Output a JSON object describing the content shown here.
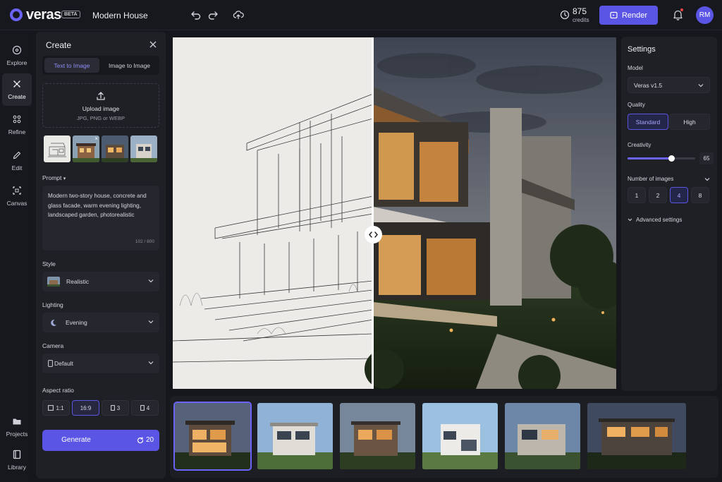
{
  "app": {
    "logo_text": "veras",
    "beta_label": "BETA",
    "project_title": "Modern House"
  },
  "topbar": {
    "credits_value": "875",
    "credits_label": "credits",
    "render_label": "Render",
    "avatar_initials": "RM"
  },
  "nav": {
    "items": [
      {
        "label": "Explore",
        "icon": "compass-icon"
      },
      {
        "label": "Create",
        "icon": "create-sparkle-icon"
      },
      {
        "label": "Refine",
        "icon": "refine-icon"
      },
      {
        "label": "Edit",
        "icon": "pencil-icon"
      },
      {
        "label": "Canvas",
        "icon": "canvas-crop-icon"
      }
    ],
    "bottom": [
      {
        "label": "Projects",
        "icon": "folder-icon"
      },
      {
        "label": "Library",
        "icon": "library-book-icon"
      }
    ]
  },
  "create": {
    "title": "Create",
    "tabs": [
      "Text to Image",
      "Image to Image"
    ],
    "upload_title": "Upload image",
    "upload_hint": "JPG, PNG or WEBP",
    "prompt_label": "Prompt",
    "prompt_text": "Modern two-story house, concrete and glass facade, warm evening lighting, landscaped garden, photorealistic",
    "prompt_counter": "102 / 800",
    "style_label": "Style",
    "style_value": "Realistic",
    "lighting_label": "Lighting",
    "lighting_value": "Evening",
    "camera_label": "Camera",
    "camera_value": "Default",
    "aspect_label": "Aspect ratio",
    "aspect_options": [
      "1:1",
      "16:9",
      "3",
      "4"
    ],
    "aspect_selected": "16:9",
    "generate_label": "Generate",
    "generate_cost": "20"
  },
  "settings": {
    "title": "Settings",
    "model_label": "Model",
    "model_value": "Veras v1.5",
    "quality_label": "Quality",
    "quality_options": [
      "Standard",
      "High"
    ],
    "quality_selected": "Standard",
    "creativity_label": "Creativity",
    "creativity_value": "65",
    "creativity_level": 0.65,
    "num_images_label": "Number of images",
    "num_images_options": [
      "1",
      "2",
      "4",
      "8"
    ],
    "num_images_selected": "4",
    "advanced_label": "Advanced settings"
  },
  "colors": {
    "accent": "#5b55e6",
    "panel": "#1f2026",
    "background": "#16171c"
  }
}
